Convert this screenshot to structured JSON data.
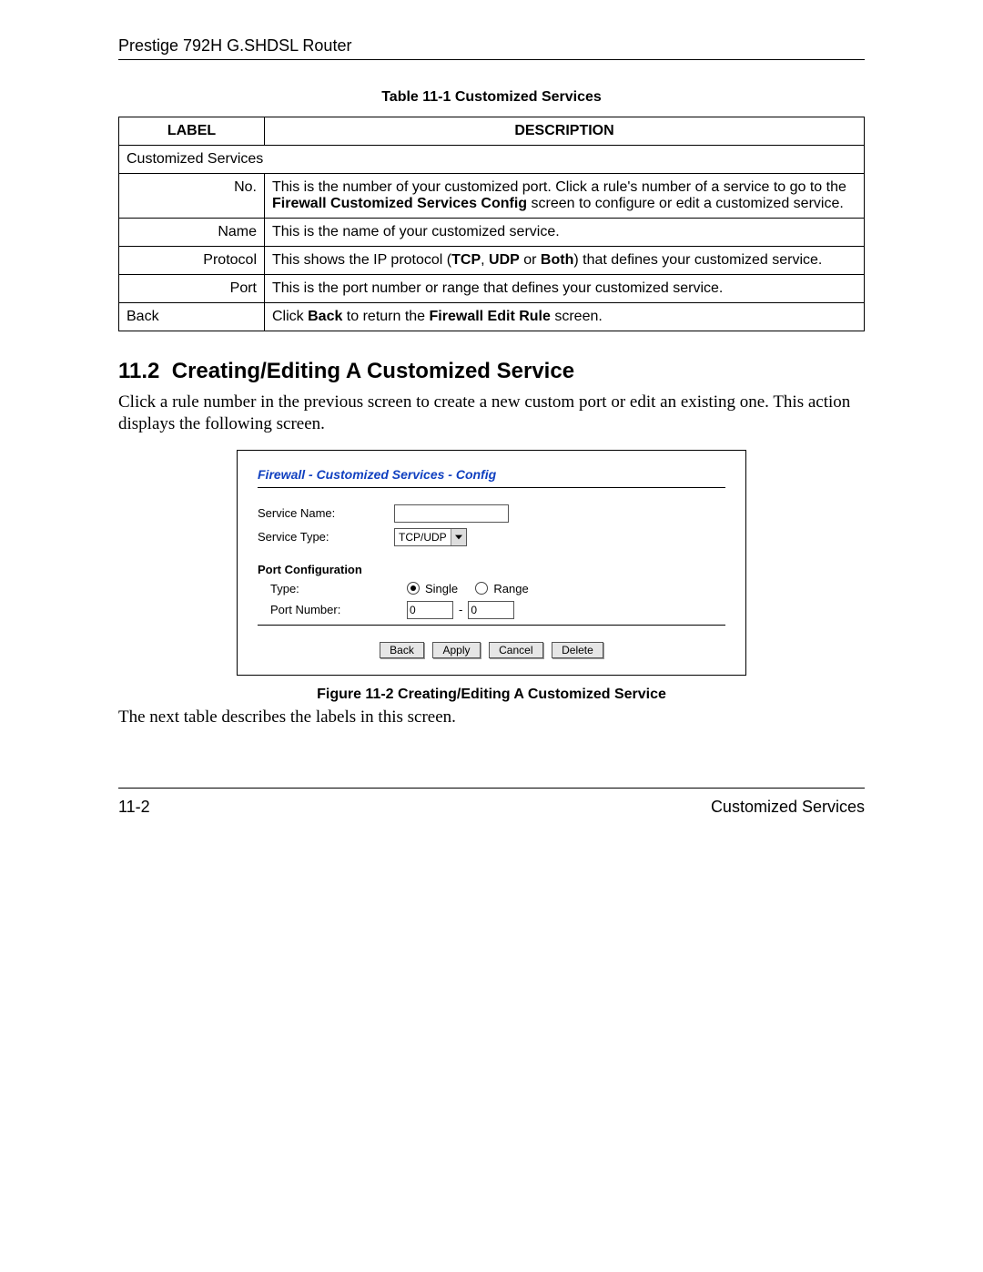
{
  "header": {
    "title": "Prestige 792H G.SHDSL Router"
  },
  "table": {
    "caption": "Table 11-1 Customized Services",
    "head_label": "LABEL",
    "head_desc": "DESCRIPTION",
    "rows": [
      {
        "label": "Customized Services",
        "left": true,
        "desc": ""
      },
      {
        "label": "No.",
        "desc_parts": [
          "This is the number of your customized port. Click a rule's number of a service to go to the ",
          {
            "b": "Firewall Customized Services Config"
          },
          " screen to configure or edit a customized service."
        ]
      },
      {
        "label": "Name",
        "desc_parts": [
          "This is the name of your customized service."
        ]
      },
      {
        "label": "Protocol",
        "desc_parts": [
          "This shows the IP protocol (",
          {
            "b": "TCP"
          },
          ", ",
          {
            "b": "UDP"
          },
          " or ",
          {
            "b": "Both"
          },
          ") that defines your customized service."
        ]
      },
      {
        "label": "Port",
        "desc_parts": [
          "This is the port number or range that defines your customized service."
        ]
      },
      {
        "label": "Back",
        "left": true,
        "desc_parts": [
          "Click ",
          {
            "b": "Back"
          },
          " to return the ",
          {
            "b": "Firewall Edit Rule"
          },
          " screen."
        ]
      }
    ]
  },
  "section": {
    "number": "11.2",
    "title": "Creating/Editing A Customized Service",
    "intro": "Click a rule number in the previous screen to create a new custom port or edit an existing one. This action displays the following screen.",
    "outro": "The next table describes the labels in this screen."
  },
  "screenshot": {
    "breadcrumb": "Firewall - Customized Services - Config",
    "service_name_label": "Service Name:",
    "service_name_value": "",
    "service_type_label": "Service Type:",
    "service_type_value": "TCP/UDP",
    "port_config_header": "Port Configuration",
    "type_label": "Type:",
    "radio_single": "Single",
    "radio_range": "Range",
    "radio_selected": "single",
    "port_number_label": "Port Number:",
    "port_from": "0",
    "port_to": "0",
    "buttons": {
      "back": "Back",
      "apply": "Apply",
      "cancel": "Cancel",
      "delete": "Delete"
    }
  },
  "figure_caption": "Figure 11-2 Creating/Editing A Customized Service",
  "footer": {
    "page": "11-2",
    "section": "Customized Services"
  }
}
